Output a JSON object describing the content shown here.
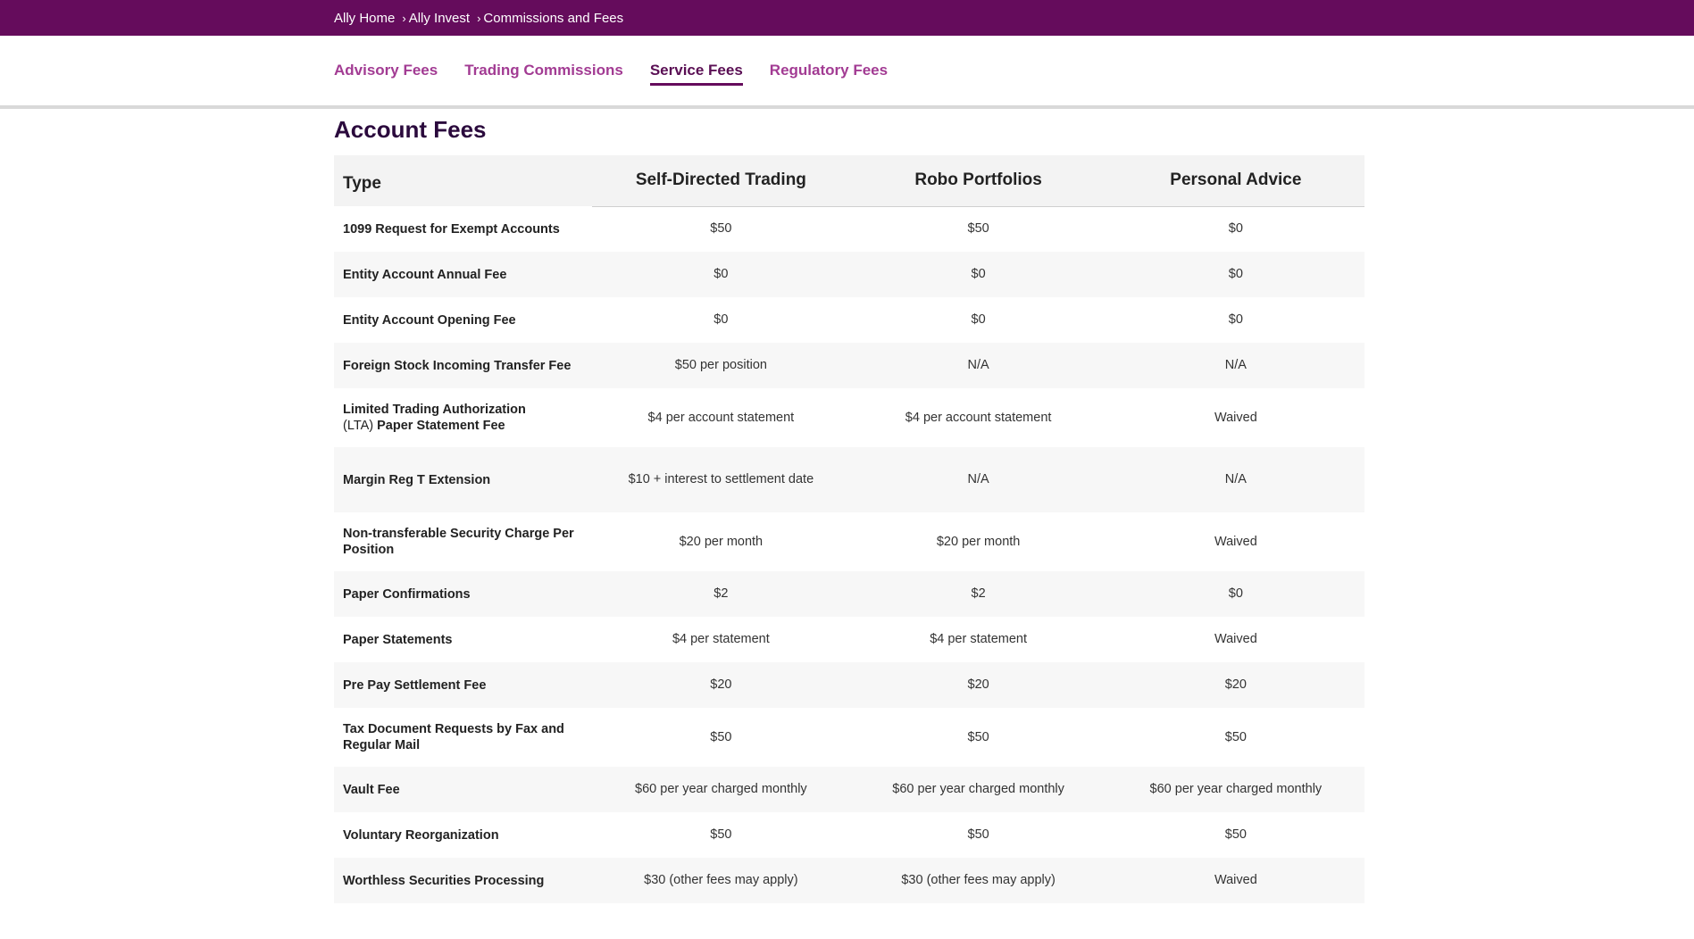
{
  "breadcrumb": [
    {
      "label": "Ally Home"
    },
    {
      "label": "Ally Invest"
    },
    {
      "label": "Commissions and Fees"
    }
  ],
  "breadcrumb_sep": "›",
  "tabs": [
    {
      "label": "Advisory Fees"
    },
    {
      "label": "Trading Commissions"
    },
    {
      "label": "Service Fees"
    },
    {
      "label": "Regulatory Fees"
    }
  ],
  "colors": {
    "brand": "#650c5c",
    "tab_link": "#a23b93",
    "title": "#2b0a3d"
  },
  "section_title": "Account Fees",
  "table": {
    "headers": [
      "Type",
      "Self-Directed Trading",
      "Robo Portfolios",
      "Personal Advice"
    ],
    "rows": [
      {
        "type": "1099 Request for Exempt Accounts",
        "self": "$50",
        "robo": "$50",
        "advice": "$0"
      },
      {
        "type": "Entity Account Annual Fee",
        "self": "$0",
        "robo": "$0",
        "advice": "$0"
      },
      {
        "type": "Entity Account Opening Fee",
        "self": "$0",
        "robo": "$0",
        "advice": "$0"
      },
      {
        "type": "Foreign Stock Incoming Transfer Fee",
        "self": "$50 per position",
        "robo": "N/A",
        "advice": "N/A"
      },
      {
        "type_a": "Limited Trading Authorization",
        "type_b": "(LTA)",
        "type_c": "Paper Statement Fee",
        "self": "$4 per account statement",
        "robo": "$4 per account statement",
        "advice": "Waived"
      },
      {
        "type": "Margin Reg T Extension",
        "self": "$10 + interest to settlement date",
        "robo": "N/A",
        "advice": "N/A"
      },
      {
        "type": "Non-transferable Security Charge Per Position",
        "self": "$20 per month",
        "robo": "$20 per month",
        "advice": "Waived"
      },
      {
        "type": "Paper Confirmations",
        "self": "$2",
        "robo": "$2",
        "advice": "$0"
      },
      {
        "type": "Paper Statements",
        "self": "$4 per statement",
        "robo": "$4 per statement",
        "advice": "Waived"
      },
      {
        "type": "Pre Pay Settlement Fee",
        "self": "$20",
        "robo": "$20",
        "advice": "$20"
      },
      {
        "type": "Tax Document Requests by Fax and Regular Mail",
        "self": "$50",
        "robo": "$50",
        "advice": "$50"
      },
      {
        "type": "Vault Fee",
        "self": "$60 per year charged monthly",
        "robo": "$60 per year charged monthly",
        "advice": "$60 per year charged monthly"
      },
      {
        "type": "Voluntary Reorganization",
        "self": "$50",
        "robo": "$50",
        "advice": "$50"
      },
      {
        "type": "Worthless Securities Processing",
        "self": "$30 (other fees may apply)",
        "robo": "$30 (other fees may apply)",
        "advice": "Waived"
      }
    ]
  }
}
